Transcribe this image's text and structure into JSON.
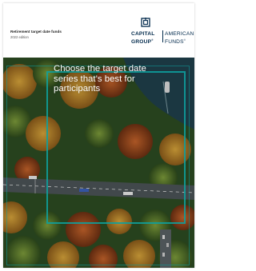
{
  "document": {
    "title": "Retirement target date funds",
    "edition": "2022 edition"
  },
  "logo": {
    "line1_left": "CAPITAL",
    "line2_left": "GROUP",
    "line1_right": "AMERICAN",
    "line2_right": "FUNDS"
  },
  "cover": {
    "headline": "Choose the target date series that’s best for participants"
  },
  "colors": {
    "navy": "#00294b",
    "teal_frame": "#0ea09e",
    "forest": "#27461f"
  }
}
